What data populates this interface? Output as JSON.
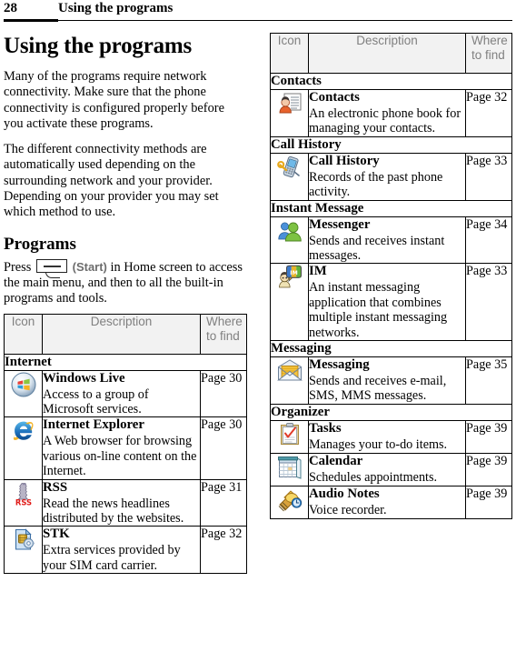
{
  "header": {
    "page_number": "28",
    "chapter": "Using the programs"
  },
  "left_column": {
    "title": "Using the programs",
    "paragraph_1": "Many of the programs require network connectivity. Make sure that the phone connectivity is configured properly before you activate these programs.",
    "paragraph_2": "The different connectivity methods are automatically used depending on the surrounding network and your provider. Depending on your provider you may set which method to use.",
    "section_title": "Programs",
    "press_prefix": "Press",
    "start_label": "(Start)",
    "press_suffix": "in Home screen to access the main menu, and then to all the built-in programs and tools."
  },
  "table_headers": {
    "icon": "Icon",
    "description": "Description",
    "where_to_find_line1": "Where",
    "where_to_find_line2": "to find"
  },
  "left_table": {
    "groups": [
      {
        "group": "Internet",
        "rows": [
          {
            "icon": "windows-live-icon",
            "name": "Windows Live",
            "description": "Access to a group of Microsoft services.",
            "page": "Page 30"
          },
          {
            "icon": "internet-explorer-icon",
            "name": "Internet Explorer",
            "description": "A Web browser for browsing various on-line content on the Internet.",
            "page": "Page 30"
          },
          {
            "icon": "rss-icon",
            "name": "RSS",
            "description": "Read the news headlines distributed by the websites.",
            "page": "Page 31"
          },
          {
            "icon": "stk-icon",
            "name": "STK",
            "description": "Extra services provided by your SIM card carrier.",
            "page": "Page 32"
          }
        ]
      }
    ]
  },
  "right_table": {
    "groups": [
      {
        "group": "Contacts",
        "rows": [
          {
            "icon": "contacts-icon",
            "name": "Contacts",
            "description": "An electronic phone book for managing your contacts.",
            "page": "Page 32"
          }
        ]
      },
      {
        "group": "Call History",
        "rows": [
          {
            "icon": "call-history-icon",
            "name": "Call History",
            "description": "Records of the past phone activity.",
            "page": "Page 33"
          }
        ]
      },
      {
        "group": "Instant Message",
        "rows": [
          {
            "icon": "messenger-icon",
            "name": "Messenger",
            "description": "Sends and receives instant messages.",
            "page": "Page 34"
          },
          {
            "icon": "im-icon",
            "name": "IM",
            "description": "An instant messaging application that combines multiple instant messaging networks.",
            "page": "Page 33"
          }
        ]
      },
      {
        "group": "Messaging",
        "rows": [
          {
            "icon": "messaging-icon",
            "name": "Messaging",
            "description": "Sends and receives e-mail, SMS, MMS messages.",
            "page": "Page 35"
          }
        ]
      },
      {
        "group": "Organizer",
        "rows": [
          {
            "icon": "tasks-icon",
            "name": "Tasks",
            "description": "Manages your to-do items.",
            "page": "Page 39"
          },
          {
            "icon": "calendar-icon",
            "name": "Calendar",
            "description": "Schedules appointments.",
            "page": "Page 39"
          },
          {
            "icon": "audio-notes-icon",
            "name": "Audio Notes",
            "description": "Voice recorder.",
            "page": "Page 39"
          }
        ]
      }
    ]
  },
  "colors": {
    "header_bg": "#f2f2f2",
    "header_text": "#808080",
    "border": "#000000",
    "start_label": "#6d6d6d"
  }
}
